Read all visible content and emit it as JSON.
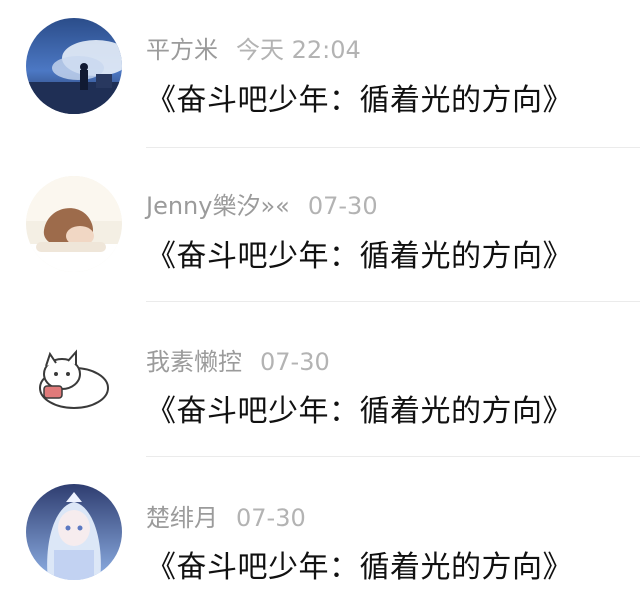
{
  "comments": [
    {
      "username": "平方米",
      "time": "今天 22:04",
      "text": "《奋斗吧少年：循着光的方向》",
      "avatar_icon": "night-sky-figure-avatar"
    },
    {
      "username": "Jenny樂汐»«",
      "time": "07-30",
      "text": "《奋斗吧少年：循着光的方向》",
      "avatar_icon": "sleeping-girl-avatar"
    },
    {
      "username": "我素懒控",
      "time": "07-30",
      "text": "《奋斗吧少年：循着光的方向》",
      "avatar_icon": "white-cat-phone-avatar"
    },
    {
      "username": "楚绯月",
      "time": "07-30",
      "text": "《奋斗吧少年：循着光的方向》",
      "avatar_icon": "anime-girl-avatar"
    }
  ]
}
